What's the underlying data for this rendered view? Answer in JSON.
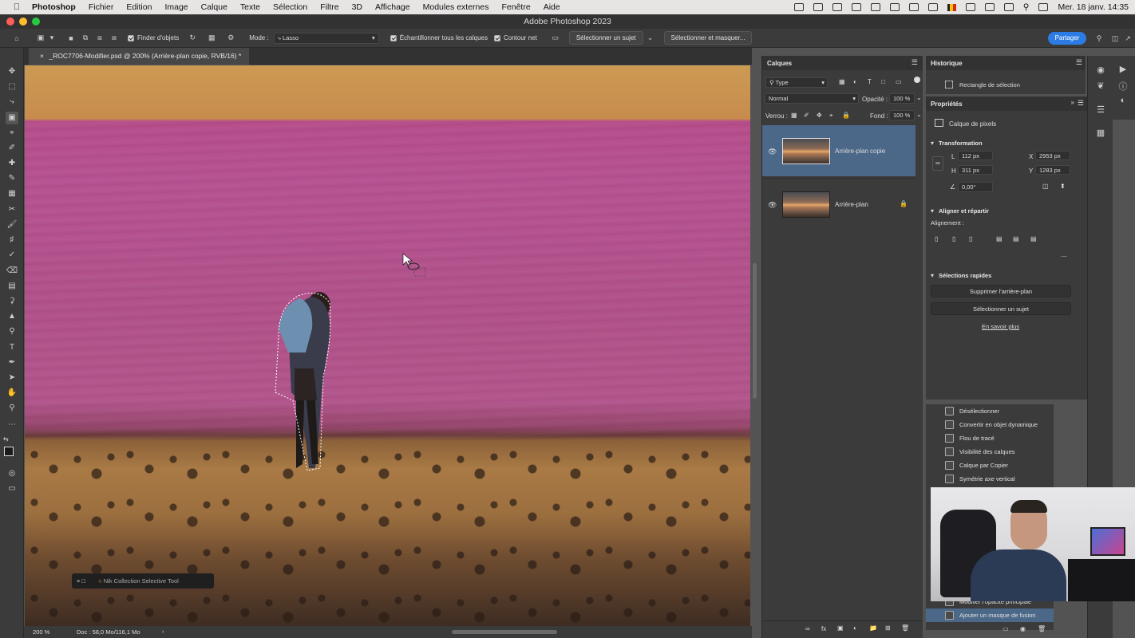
{
  "menubar": {
    "app": "Photoshop",
    "menus": [
      "Fichier",
      "Edition",
      "Image",
      "Calque",
      "Texte",
      "Sélection",
      "Filtre",
      "3D",
      "Affichage",
      "Modules externes",
      "Fenêtre",
      "Aide"
    ],
    "clock": "Mer. 18 janv.  14:35"
  },
  "window": {
    "title": "Adobe Photoshop 2023"
  },
  "options": {
    "finder_label": "Finder d'objets",
    "mode_label": "Mode :",
    "mode_value": "Lasso",
    "sample_all_label": "Échantillonner tous les calques",
    "hard_edge_label": "Contour net",
    "select_subject": "Sélectionner un sujet",
    "select_mask": "Sélectionner et masquer...",
    "share": "Partager"
  },
  "document": {
    "tab": "_ROC7706-Modifier.psd @ 200% (Arrière-plan copie, RVB/16) *",
    "zoom": "200 %",
    "doc_info": "Doc : 58,0 Mo/116,1 Mo",
    "nik_label": "Nik Collection Selective Tool"
  },
  "layers_panel": {
    "title": "Calques",
    "filter": "Type",
    "blend_mode": "Normal",
    "opacity_label": "Opacité :",
    "opacity": "100 %",
    "lock_label": "Verrou :",
    "fill_label": "Fond :",
    "fill": "100 %",
    "layers": [
      {
        "name": "Arrière-plan copie",
        "selected": true
      },
      {
        "name": "Arrière-plan",
        "selected": false,
        "locked": true
      }
    ]
  },
  "history_top": {
    "title": "Historique",
    "item": "Rectangle de sélection"
  },
  "properties": {
    "title": "Propriétés",
    "kind": "Calque de pixels",
    "transform_title": "Transformation",
    "L": "112 px",
    "H": "311 px",
    "X": "2953 px",
    "Y": "1283 px",
    "angle": "0,00°",
    "align_title": "Aligner et répartir",
    "align_label": "Alignement :",
    "quick_title": "Sélections rapides",
    "remove_bg": "Supprimer l'arrière-plan",
    "select_subject": "Sélectionner un sujet",
    "learn_more": "En savoir plus"
  },
  "history_list": [
    "Désélectionner",
    "Convertir en objet dynamique",
    "Flou de tracé",
    "Visibilité des calques",
    "Calque par Copier",
    "Symétrie axe vertical",
    "Modifier l'opacité principale",
    "Ajouter un masque de fusion"
  ],
  "colors": {
    "accent": "#2d7ce5",
    "overlay": "#b5508f",
    "panel_bg": "#3b3b3b",
    "selected_layer": "#4b6888"
  }
}
